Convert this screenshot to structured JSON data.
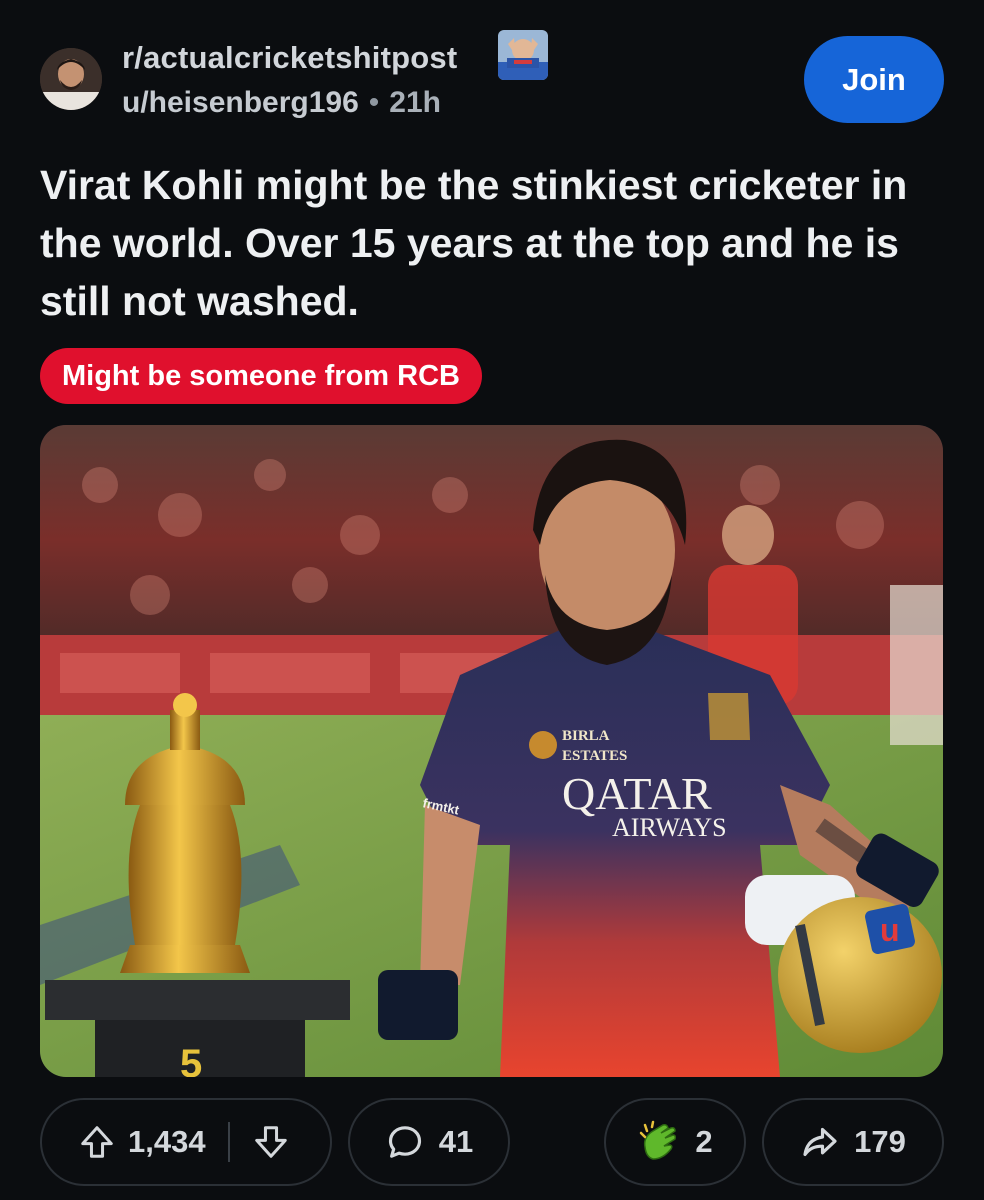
{
  "header": {
    "subreddit": "r/actualcricketshitpost",
    "username": "u/heisenberg196",
    "separator": "•",
    "time_ago": "21h",
    "join_label": "Join"
  },
  "post": {
    "title": "Virat Kohli might be the stinkiest cricketer in the world. Over 15 years at the top and he is still not washed.",
    "flair": "Might be someone from RCB",
    "image": {
      "jersey_sponsor_top": "BIRLA",
      "jersey_sponsor_bottom": "ESTATES",
      "jersey_main_1": "QATAR",
      "jersey_main_2": "AIRWAYS",
      "sleeve_text": "frmtkt",
      "helmet_letter": "u",
      "trophy_plinth_mark": "5"
    }
  },
  "actions": {
    "upvotes": "1,434",
    "comments": "41",
    "awards": "2",
    "shares": "179"
  },
  "colors": {
    "background": "#0b0d10",
    "join_button": "#1665d8",
    "flair_bg": "#e0102d",
    "pill_border": "#2b3036"
  },
  "icons": {
    "upvote": "arrow-up-icon",
    "downvote": "arrow-down-icon",
    "comment": "speech-bubble-icon",
    "award": "clapping-award-icon",
    "share": "share-arrow-icon"
  }
}
